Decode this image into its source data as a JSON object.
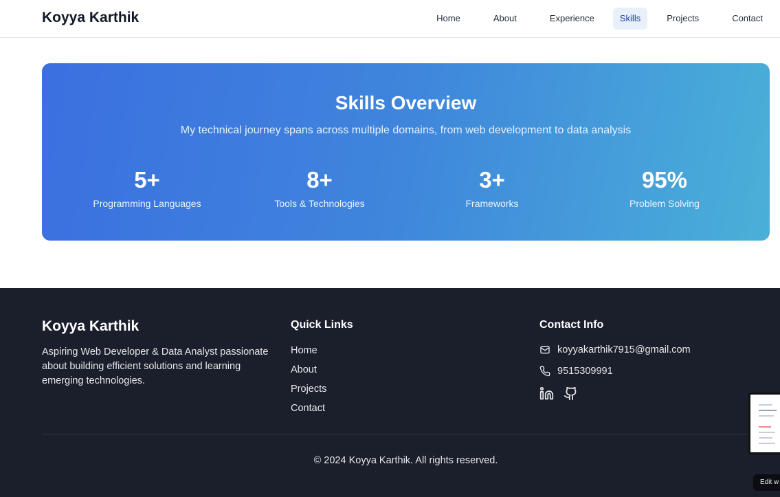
{
  "header": {
    "brand": "Koyya Karthik",
    "nav": [
      "Home",
      "About",
      "Experience",
      "Skills",
      "Projects",
      "Contact"
    ],
    "active": "Skills"
  },
  "hero": {
    "title": "Skills Overview",
    "subtitle": "My technical journey spans across multiple domains, from web development to data analysis",
    "stats": [
      {
        "value": "5+",
        "label": "Programming Languages"
      },
      {
        "value": "8+",
        "label": "Tools & Technologies"
      },
      {
        "value": "3+",
        "label": "Frameworks"
      },
      {
        "value": "95%",
        "label": "Problem Solving"
      }
    ]
  },
  "footer": {
    "brand": "Koyya Karthik",
    "description": "Aspiring Web Developer & Data Analyst passionate about building efficient solutions and learning emerging technologies.",
    "quick_links_title": "Quick Links",
    "quick_links": [
      "Home",
      "About",
      "Projects",
      "Contact"
    ],
    "contact_title": "Contact Info",
    "email": "koyyakarthik7915@gmail.com",
    "phone": "9515309991",
    "social_icons": [
      "linkedin-icon",
      "github-icon"
    ],
    "copyright": "© 2024 Koyya Karthik. All rights reserved."
  },
  "overlay": {
    "edit_label": "Edit w"
  },
  "colors": {
    "hero_gradient_start": "#3b6fe0",
    "hero_gradient_end": "#4ab0d8",
    "footer_bg": "#1a1f2b",
    "nav_active_bg": "#e8f0fb"
  }
}
